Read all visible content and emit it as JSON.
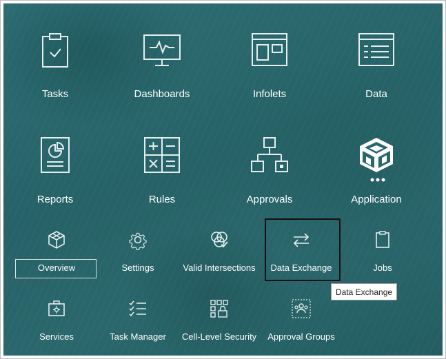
{
  "tiles": [
    {
      "label": "Tasks",
      "icon": "clipboard-check-icon"
    },
    {
      "label": "Dashboards",
      "icon": "monitor-chart-icon"
    },
    {
      "label": "Infolets",
      "icon": "infolets-icon"
    },
    {
      "label": "Data",
      "icon": "data-grid-icon"
    },
    {
      "label": "Reports",
      "icon": "report-chart-icon"
    },
    {
      "label": "Rules",
      "icon": "calculator-icon"
    },
    {
      "label": "Approvals",
      "icon": "hierarchy-icon"
    },
    {
      "label": "Application",
      "icon": "cube-icon"
    }
  ],
  "sub_items": [
    {
      "label": "Overview",
      "icon": "cube-small-icon"
    },
    {
      "label": "Settings",
      "icon": "gear-icon"
    },
    {
      "label": "Valid Intersections",
      "icon": "intersection-icon"
    },
    {
      "label": "Data Exchange",
      "icon": "arrows-exchange-icon"
    },
    {
      "label": "Jobs",
      "icon": "clipboard-icon"
    },
    {
      "label": "Services",
      "icon": "toolbox-icon"
    },
    {
      "label": "Task Manager",
      "icon": "checklist-icon"
    },
    {
      "label": "Cell-Level Security",
      "icon": "grid-lock-icon"
    },
    {
      "label": "Approval Groups",
      "icon": "group-icon"
    }
  ],
  "tooltip": {
    "text": "Data Exchange"
  },
  "colors": {
    "background": "#2a676c",
    "icon_stroke": "#e6efef",
    "text": "#ffffff"
  }
}
